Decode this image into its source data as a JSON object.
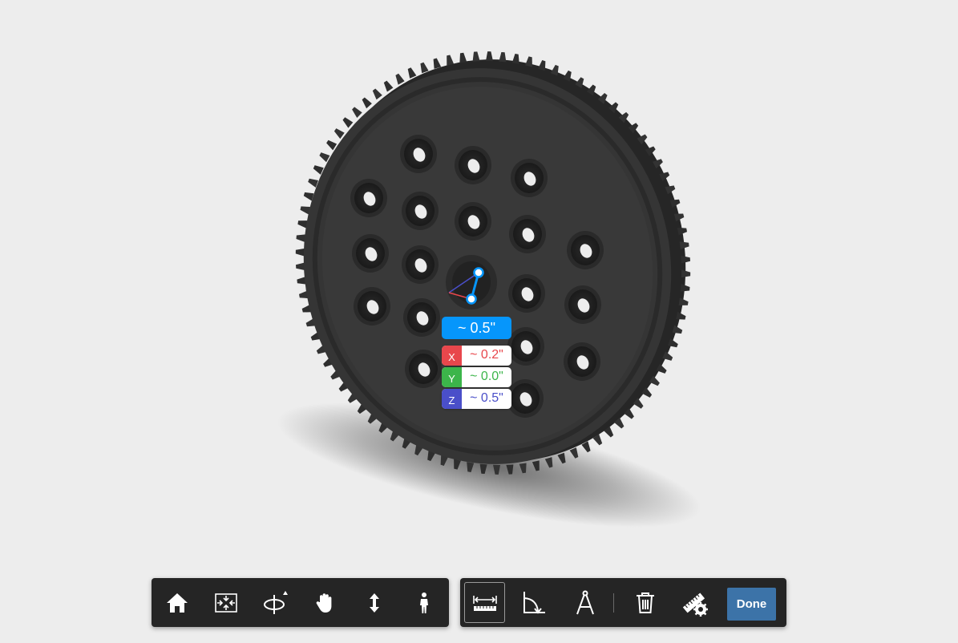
{
  "measurement": {
    "distance": "~ 0.5\"",
    "axes": [
      {
        "axis": "X",
        "value": "~ 0.2\"",
        "color": "#e8474c"
      },
      {
        "axis": "Y",
        "value": "~ 0.0\"",
        "color": "#3cb54a"
      },
      {
        "axis": "Z",
        "value": "~ 0.5\"",
        "color": "#4a4fc9"
      }
    ],
    "accent_color": "#0696fb"
  },
  "nav_toolbar": {
    "items": [
      "home-icon",
      "fit-to-view-icon",
      "orbit-icon",
      "pan-icon",
      "zoom-icon",
      "first-person-icon"
    ]
  },
  "measure_toolbar": {
    "items": [
      "distance-measure-icon",
      "angle-measure-icon",
      "area-measure-icon",
      "delete-icon",
      "measure-settings-icon"
    ],
    "active": "distance-measure-icon",
    "done_label": "Done",
    "done_color": "#3c73a8"
  }
}
